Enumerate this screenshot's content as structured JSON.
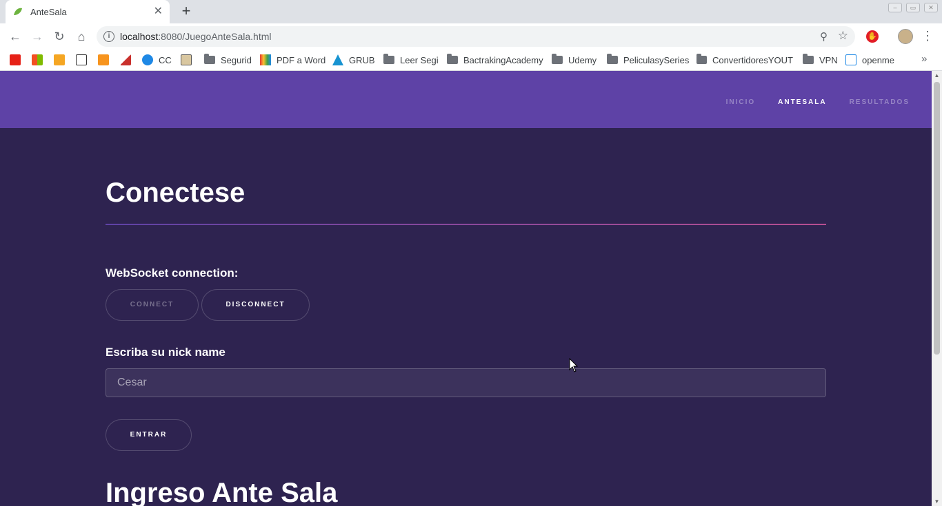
{
  "browser": {
    "tab_title": "AnteSala",
    "new_tab": "+",
    "url_host": "localhost",
    "url_rest": ":8080/JuegoAnteSala.html",
    "bookmarks": [
      {
        "label": "CC",
        "type": "site"
      },
      {
        "label": "Segurid",
        "type": "folder"
      },
      {
        "label": "PDF a Word",
        "type": "site"
      },
      {
        "label": "GRUB",
        "type": "site"
      },
      {
        "label": "Leer Segi",
        "type": "folder"
      },
      {
        "label": "BactrakingAcademy",
        "type": "folder"
      },
      {
        "label": "Udemy",
        "type": "folder"
      },
      {
        "label": "PeliculasySeries",
        "type": "folder"
      },
      {
        "label": "ConvertidoresYOUT",
        "type": "folder"
      },
      {
        "label": "VPN",
        "type": "folder"
      },
      {
        "label": "openme",
        "type": "site"
      }
    ]
  },
  "nav": {
    "items": [
      {
        "label": "INICIO",
        "active": false
      },
      {
        "label": "ANTESALA",
        "active": true
      },
      {
        "label": "RESULTADOS",
        "active": false
      }
    ]
  },
  "main": {
    "heading": "Conectese",
    "ws_label": "WebSocket connection:",
    "connect_label": "CONNECT",
    "disconnect_label": "DISCONNECT",
    "nick_label": "Escriba su nick name",
    "nick_placeholder": "Cesar",
    "enter_label": "ENTRAR",
    "heading2": "Ingreso Ante Sala"
  },
  "colors": {
    "header_bg": "#5e42a6",
    "page_bg": "#2e2350",
    "accent_gradient_end": "#b74e91"
  }
}
